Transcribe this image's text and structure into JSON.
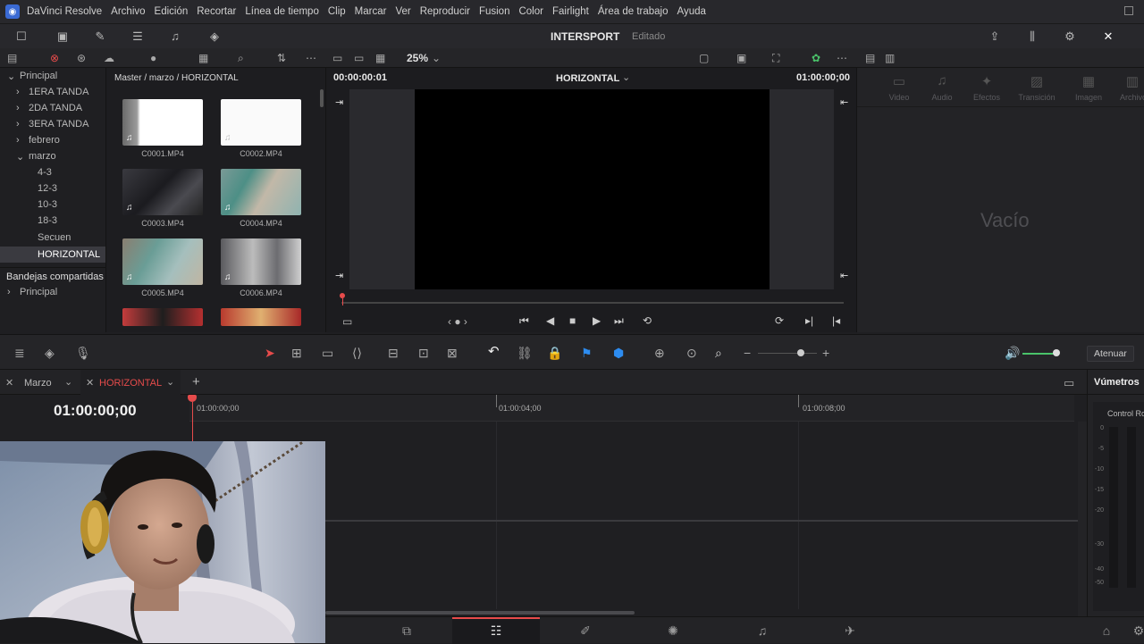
{
  "menu": {
    "app": "DaVinci Resolve",
    "items": [
      "Archivo",
      "Edición",
      "Recortar",
      "Línea de tiempo",
      "Clip",
      "Marcar",
      "Ver",
      "Reproducir",
      "Fusion",
      "Color",
      "Fairlight",
      "Área de trabajo",
      "Ayuda"
    ]
  },
  "project": {
    "title": "INTERSPORT",
    "status": "Editado"
  },
  "viewer": {
    "zoom": "25%",
    "timecode_left": "00:00:00:01",
    "title": "HORIZONTAL",
    "timecode_right": "01:00:00;00"
  },
  "bins": {
    "path": "Master / marzo / HORIZONTAL",
    "items": [
      "Principal",
      "1ERA TANDA",
      "2DA TANDA",
      "3ERA TANDA",
      "febrero",
      "marzo",
      "4-3",
      "12-3",
      "10-3",
      "18-3",
      "Secuen",
      "HORIZONTAL"
    ],
    "shared_header": "Bandejas compartidas",
    "shared_items": [
      "Principal"
    ]
  },
  "clips": [
    "C0001.MP4",
    "C0002.MP4",
    "C0003.MP4",
    "C0004.MP4",
    "C0005.MP4",
    "C0006.MP4"
  ],
  "inspector": {
    "tabs": [
      "Video",
      "Audio",
      "Efectos",
      "Transición",
      "Imagen",
      "Archivo"
    ],
    "empty": "Vacío"
  },
  "midbar": {
    "atenuar": "Atenuar"
  },
  "timeline": {
    "tabs": [
      "Marzo",
      "HORIZONTAL"
    ],
    "timecode": "01:00:00;00",
    "ruler": [
      "01:00:00;00",
      "01:00:04;00",
      "01:00:08;00"
    ]
  },
  "meters": {
    "title": "Vúmetros",
    "control": "Control Ro",
    "scale": [
      "0",
      "-5",
      "-10",
      "-15",
      "-20",
      "-30",
      "-40",
      "-50"
    ]
  },
  "colors": {
    "accent_red": "#e64b4b",
    "accent_blue": "#2d8cf0",
    "bg": "#1f1f22"
  }
}
